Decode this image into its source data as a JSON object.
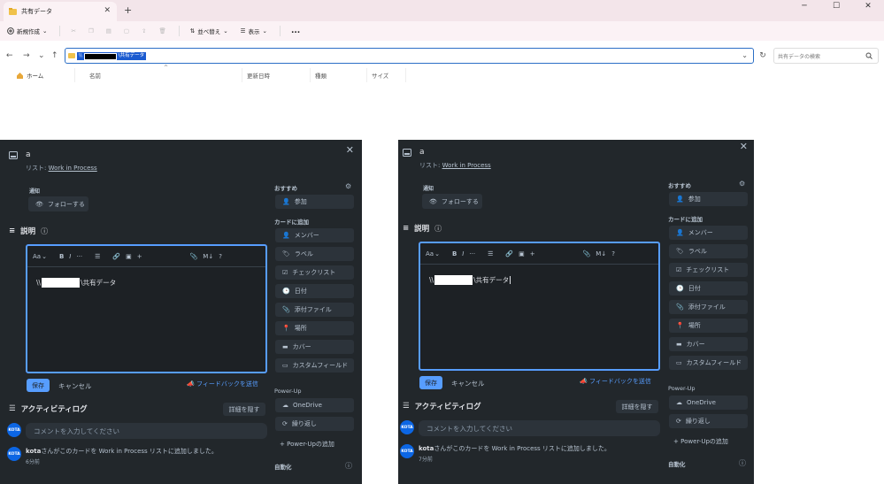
{
  "explorer": {
    "tab_title": "共有データ",
    "window_controls": [
      "─",
      "☐",
      "✕"
    ],
    "toolbar": {
      "new": "新規作成",
      "sort": "並べ替え",
      "view": "表示",
      "more": "..."
    },
    "address": {
      "prefix": "\\\\",
      "suffix": "\\共有データ"
    },
    "search_placeholder": "共有データの検索",
    "nav_home": "ホーム",
    "columns": [
      "名前",
      "更新日時",
      "種類",
      "サイズ"
    ]
  },
  "card": {
    "title": "a",
    "list_prefix": "リスト: ",
    "list_name": "Work in Process",
    "notifications_label": "通知",
    "follow_button": "フォローする",
    "description_heading": "説明",
    "editor_toolbar": {
      "text_style": "Aa",
      "bold": "B",
      "italic": "I",
      "more": "···",
      "list": "☰",
      "link": "🔗",
      "image": "▣",
      "plus": "+",
      "attach": "📎",
      "markdown": "M↓",
      "help": "?"
    },
    "editor_text_prefix": "\\\\",
    "editor_text_suffix": "\\共有データ",
    "save": "保存",
    "cancel": "キャンセル",
    "feedback": "フィードバックを送信",
    "activity_heading": "アクティビティログ",
    "hide_details": "詳細を隠す",
    "comment_placeholder": "コメントを入力してください",
    "avatar_initials": "KOTA",
    "activity_user": "kota",
    "activity_text": "さんがこのカードを Work in Process リストに追加しました。",
    "left_time": "6分前",
    "right_time": "7分前",
    "sidebar": {
      "recommended": "おすすめ",
      "join": "参加",
      "add_to_card": "カードに追加",
      "members": "メンバー",
      "labels": "ラベル",
      "checklist": "チェックリスト",
      "dates": "日付",
      "attachment": "添付ファイル",
      "location": "場所",
      "cover": "カバー",
      "custom_fields": "カスタムフィールド",
      "powerups": "Power-Up",
      "onedrive": "OneDrive",
      "repeat": "繰り返し",
      "add_powerup": "Power-Upの追加",
      "automation": "自動化"
    }
  },
  "colors": {
    "panel_bg": "#22272b",
    "accent": "#579dff",
    "avatar": "#0c66e4",
    "selection": "#1c5bd0"
  }
}
